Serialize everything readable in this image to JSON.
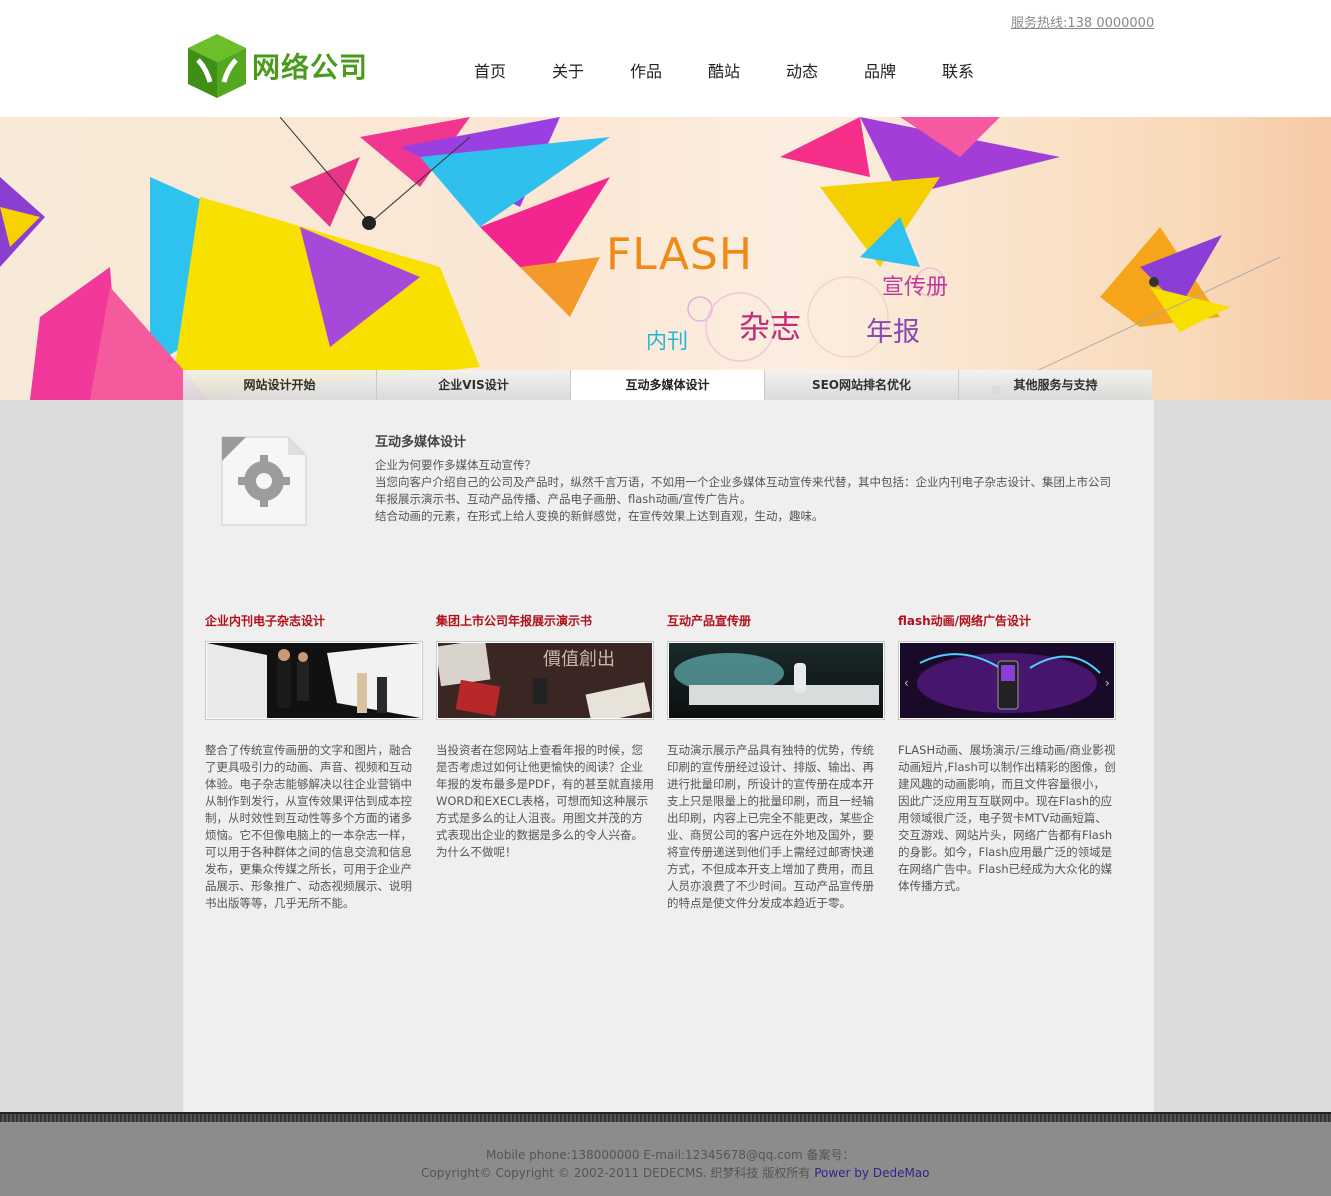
{
  "header": {
    "hotline": "服务热线:138 0000000",
    "logo_text": "网络公司",
    "nav": [
      "首页",
      "关于",
      "作品",
      "酷站",
      "动态",
      "品牌",
      "联系"
    ]
  },
  "banner": {
    "flash": "FLASH",
    "brochure": "宣传册",
    "magazine": "杂志",
    "annual_report": "年报",
    "internal": "内刊"
  },
  "tabs": {
    "items": [
      "网站设计开始",
      "企业VIS设计",
      "互动多媒体设计",
      "SEO网站排名优化",
      "其他服务与支持"
    ],
    "active": "互动多媒体设计"
  },
  "intro": {
    "title": "互动多媒体设计",
    "line1": "企业为何要作多媒体互动宣传？",
    "line2": "当您向客户介绍自己的公司及产品时，纵然千言万语，不如用一个企业多媒体互动宣传来代替，其中包括：企业内刊电子杂志设计、集团上市公司年报展示演示书、互动产品传播、产品电子画册、flash动画/宣传广告片。",
    "line3": "结合动画的元素，在形式上给人变换的新鲜感觉，在宣传效果上达到直观，生动，趣味。"
  },
  "columns": [
    {
      "title": "企业内刊电子杂志设计",
      "text": "整合了传统宣传画册的文字和图片，融合了更具吸引力的动画、声音、视频和互动体验。电子杂志能够解决以往企业营销中从制作到发行，从宣传效果评估到成本控制，从时效性到互动性等多个方面的诸多烦恼。它不但像电脑上的一本杂志一样，可以用于各种群体之间的信息交流和信息发布，更集众传媒之所长，可用于企业产品展示、形象推广、动态视频展示、说明书出版等等，几乎无所不能。"
    },
    {
      "title": "集团上市公司年报展示演示书",
      "image_text": "價值創出",
      "text": "当投资者在您网站上查看年报的时候，您是否考虑过如何让他更愉快的阅读？企业年报的发布最多是PDF，有的甚至就直接用WORD和EXECL表格，可想而知这种展示方式是多么的让人沮丧。用图文并茂的方式表现出企业的数据是多么的令人兴奋。为什么不做呢！"
    },
    {
      "title": "互动产品宣传册",
      "text": "互动演示展示产品具有独特的优势，传统印刷的宣传册经过设计、排版、输出、再进行批量印刷，所设计的宣传册在成本开支上只是限量上的批量印刷，而且一经输出印刷，内容上已完全不能更改，某些企业、商贸公司的客户远在外地及国外，要将宣传册递送到他们手上需经过邮寄快递方式，不但成本开支上增加了费用，而且人员亦浪费了不少时间。互动产品宣传册的特点是使文件分发成本趋近于零。"
    },
    {
      "title": "flash动画/网络广告设计",
      "text": "FLASH动画、展场演示/三维动画/商业影视动画短片,Flash可以制作出精彩的图像，创建风趣的动画影响，而且文件容量很小，因此广泛应用互互联网中。现在Flash的应用领域很广泛，电子贺卡MTV动画短篇、交互游戏、网站片头，网络广告都有Flash的身影。如今，Flash应用最广泛的领域是在网络广告中。Flash已经成为大众化的媒体传播方式。"
    }
  ],
  "footer": {
    "line1": "Mobile phone:138000000  E-mail:12345678@qq.com  备案号：",
    "line2": "Copyright© Copyright © 2002-2011 DEDECMS. 织梦科技 版权所有 ",
    "power": "Power by DedeMao"
  }
}
